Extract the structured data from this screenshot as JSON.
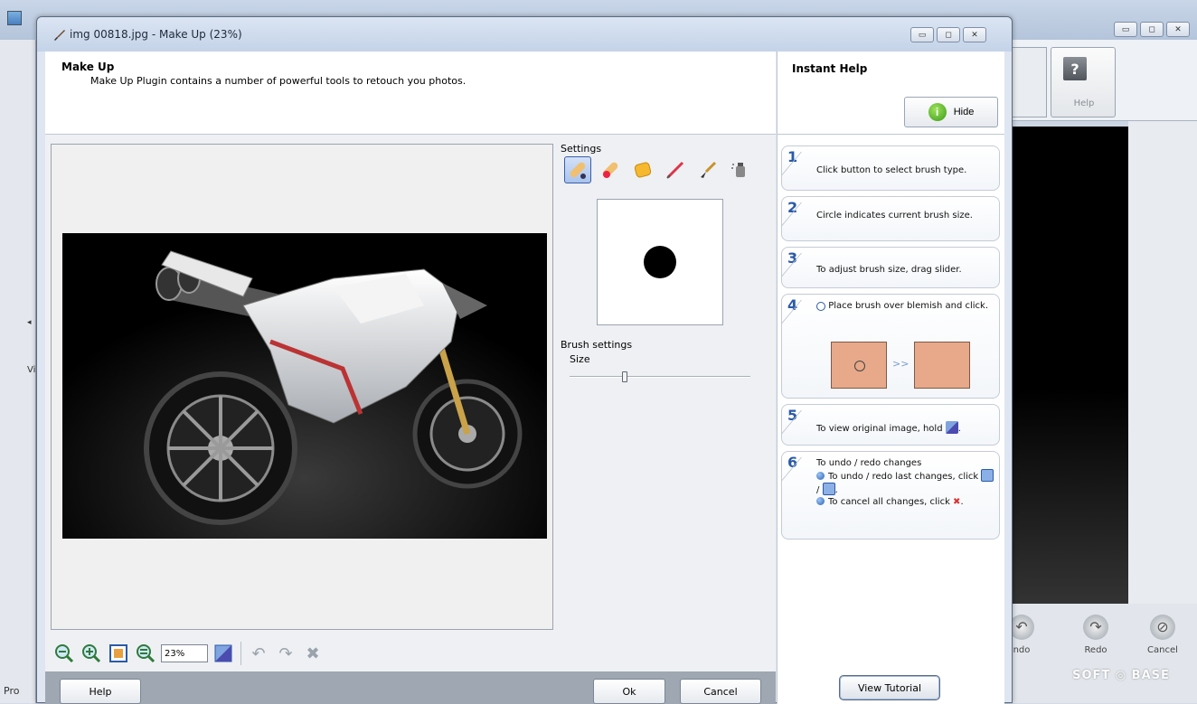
{
  "background_app": {
    "help_label": "Help",
    "left_strip_label": "Vi",
    "left_bottom_text": "Pro",
    "bottom_buttons": [
      {
        "label": "ndo",
        "icon": "undo-icon"
      },
      {
        "label": "Redo",
        "icon": "redo-icon"
      },
      {
        "label": "Cancel",
        "icon": "cancel-icon"
      }
    ],
    "watermark": "SOFT ◎ BASE"
  },
  "dialog": {
    "title": "img 00818.jpg - Make Up (23%)",
    "header": {
      "title": "Make Up",
      "description": "Make Up Plugin contains a number of powerful tools to retouch you photos."
    },
    "settings": {
      "label": "Settings",
      "brush_tools": [
        "healing-brush-icon",
        "blemish-brush-icon",
        "sponge-icon",
        "brush-pen-icon",
        "paint-brush-icon",
        "spray-icon"
      ],
      "selected_tool_index": 0,
      "brush_settings_label": "Brush settings",
      "size_label": "Size",
      "size_value_fraction": 0.3
    },
    "view_toolbar": {
      "zoom_value": "23%"
    },
    "footer": {
      "help": "Help",
      "ok": "Ok",
      "cancel": "Cancel"
    }
  },
  "instant_help": {
    "title": "Instant Help",
    "hide_label": "Hide",
    "steps": [
      {
        "num": "1",
        "text": "Click button to select brush type."
      },
      {
        "num": "2",
        "text": "Circle indicates current brush size."
      },
      {
        "num": "3",
        "text": "To adjust brush size, drag slider."
      },
      {
        "num": "4",
        "text": "Place brush over blemish and click.",
        "arrow": ">>"
      },
      {
        "num": "5",
        "text": "To view original image, hold"
      },
      {
        "num": "6",
        "text": "To undo / redo changes",
        "bullets": [
          "To undo / redo last changes, click",
          "To cancel all changes, click"
        ],
        "bullet1_suffix": ".",
        "separator": "/",
        "bullet2_suffix": "."
      }
    ],
    "step5_suffix": ".",
    "view_tutorial": "View Tutorial"
  }
}
